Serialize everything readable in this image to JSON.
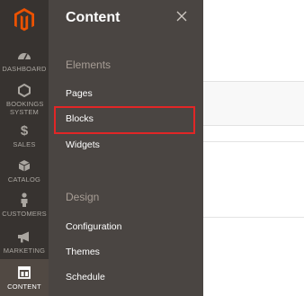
{
  "sidebar": {
    "items": [
      {
        "label": "DASHBOARD",
        "icon": "dashboard-icon"
      },
      {
        "label": "BOOKINGS SYSTEM",
        "icon": "hexagon-icon"
      },
      {
        "label": "SALES",
        "icon": "dollar-icon"
      },
      {
        "label": "CATALOG",
        "icon": "box-icon"
      },
      {
        "label": "CUSTOMERS",
        "icon": "person-icon"
      },
      {
        "label": "MARKETING",
        "icon": "megaphone-icon"
      },
      {
        "label": "CONTENT",
        "icon": "layout-icon"
      }
    ],
    "active": "CONTENT"
  },
  "panel": {
    "title": "Content",
    "sections": [
      {
        "title": "Elements",
        "links": [
          "Pages",
          "Blocks",
          "Widgets"
        ]
      },
      {
        "title": "Design",
        "links": [
          "Configuration",
          "Themes",
          "Schedule"
        ]
      }
    ],
    "highlighted_link": "Blocks"
  },
  "colors": {
    "sidebar_bg": "#373330",
    "panel_bg": "#4a4542",
    "logo_orange": "#eb5202",
    "highlight_red": "#e22626"
  }
}
